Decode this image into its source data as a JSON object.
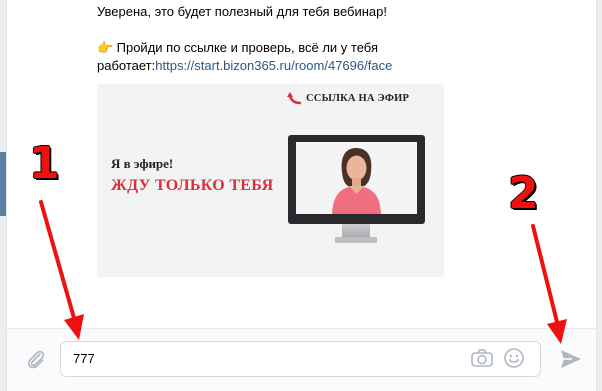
{
  "message": {
    "line1": "Уверена, это будет полезный для тебя вебинар!",
    "line2_text": "Пройди по ссылке и проверь, всё ли у тебя",
    "line3_prefix": "работает:",
    "link_text": "https://start.bizon365.ru/room/47696/face",
    "pointer_emoji": "👉"
  },
  "banner": {
    "link_label": "ССЫЛКА НА ЭФИР",
    "line1": "Я в эфире!",
    "line2": "ЖДУ ТОЛЬКО ТЕБЯ"
  },
  "composer": {
    "input_value": "777"
  },
  "annotations": {
    "marker_1": "1",
    "marker_2": "2",
    "color": "#ee1111"
  },
  "icons": {
    "attach": "paperclip-icon",
    "camera": "camera-icon",
    "emoji": "smile-icon",
    "send": "send-icon"
  },
  "colors": {
    "link": "#2a5885",
    "accent_red": "#d7303c",
    "sidebar_accent": "#5b7fa6"
  }
}
